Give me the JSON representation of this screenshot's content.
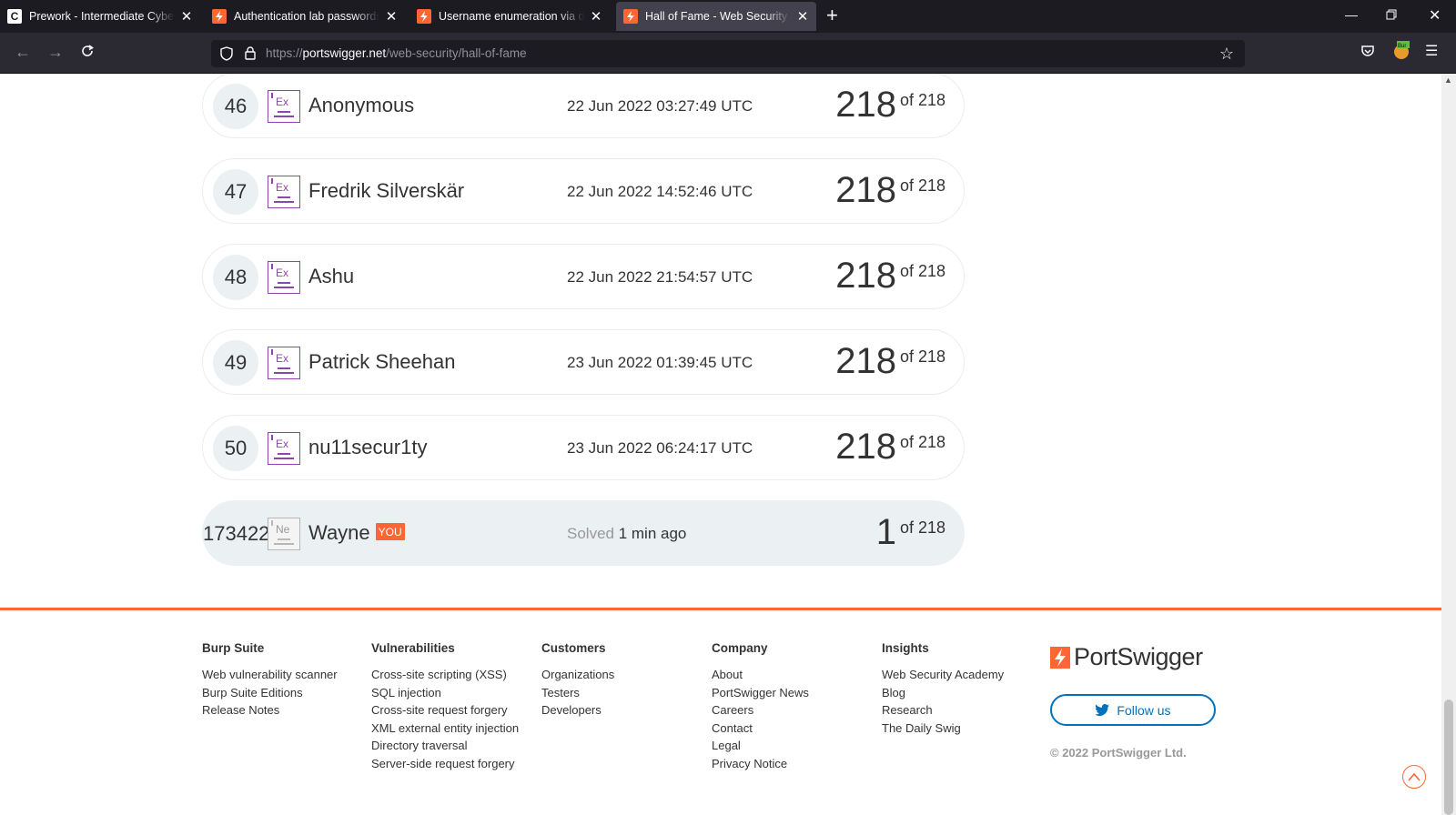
{
  "browser": {
    "tabs": [
      {
        "title": "Prework - Intermediate Cybersec",
        "icon": "codepath-icon"
      },
      {
        "title": "Authentication lab passwords | Web",
        "icon": "portswigger-icon"
      },
      {
        "title": "Username enumeration via different",
        "icon": "portswigger-icon"
      },
      {
        "title": "Hall of Fame - Web Security Academy",
        "icon": "portswigger-icon",
        "active": true
      }
    ],
    "new_tab": "+",
    "url_scheme": "https://",
    "url_host": "portswigger.net",
    "url_path": "/web-security/hall-of-fame"
  },
  "leaderboard": {
    "rows": [
      {
        "rank": "46",
        "level": "Ex",
        "name": "Anonymous",
        "date": "22 Jun 2022 03:27:49 UTC",
        "score": "218",
        "total": "of 218"
      },
      {
        "rank": "47",
        "level": "Ex",
        "name": "Fredrik Silverskär",
        "date": "22 Jun 2022 14:52:46 UTC",
        "score": "218",
        "total": "of 218"
      },
      {
        "rank": "48",
        "level": "Ex",
        "name": "Ashu",
        "date": "22 Jun 2022 21:54:57 UTC",
        "score": "218",
        "total": "of 218"
      },
      {
        "rank": "49",
        "level": "Ex",
        "name": "Patrick Sheehan",
        "date": "23 Jun 2022 01:39:45 UTC",
        "score": "218",
        "total": "of 218"
      },
      {
        "rank": "50",
        "level": "Ex",
        "name": "nu11secur1ty",
        "date": "23 Jun 2022 06:24:17 UTC",
        "score": "218",
        "total": "of 218"
      }
    ],
    "current_user": {
      "rank": "173422",
      "level": "Ne",
      "name": "Wayne",
      "you_tag": "YOU",
      "solved_prefix": "Solved",
      "solved_time": "1 min ago",
      "score": "1",
      "total": "of 218"
    }
  },
  "footer": {
    "columns": [
      {
        "heading": "Burp Suite",
        "links": [
          "Web vulnerability scanner",
          "Burp Suite Editions",
          "Release Notes"
        ]
      },
      {
        "heading": "Vulnerabilities",
        "links": [
          "Cross-site scripting (XSS)",
          "SQL injection",
          "Cross-site request forgery",
          "XML external entity injection",
          "Directory traversal",
          "Server-side request forgery"
        ]
      },
      {
        "heading": "Customers",
        "links": [
          "Organizations",
          "Testers",
          "Developers"
        ]
      },
      {
        "heading": "Company",
        "links": [
          "About",
          "PortSwigger News",
          "Careers",
          "Contact",
          "Legal",
          "Privacy Notice"
        ]
      },
      {
        "heading": "Insights",
        "links": [
          "Web Security Academy",
          "Blog",
          "Research",
          "The Daily Swig"
        ]
      }
    ],
    "brand": "PortSwigger",
    "follow_label": "Follow us",
    "copyright": "© 2022 PortSwigger Ltd."
  },
  "colors": {
    "accent": "#ff6633",
    "expert_badge": "#8e44ad",
    "twitter_blue": "#0071bc",
    "row_highlight": "#ebf0f2"
  }
}
